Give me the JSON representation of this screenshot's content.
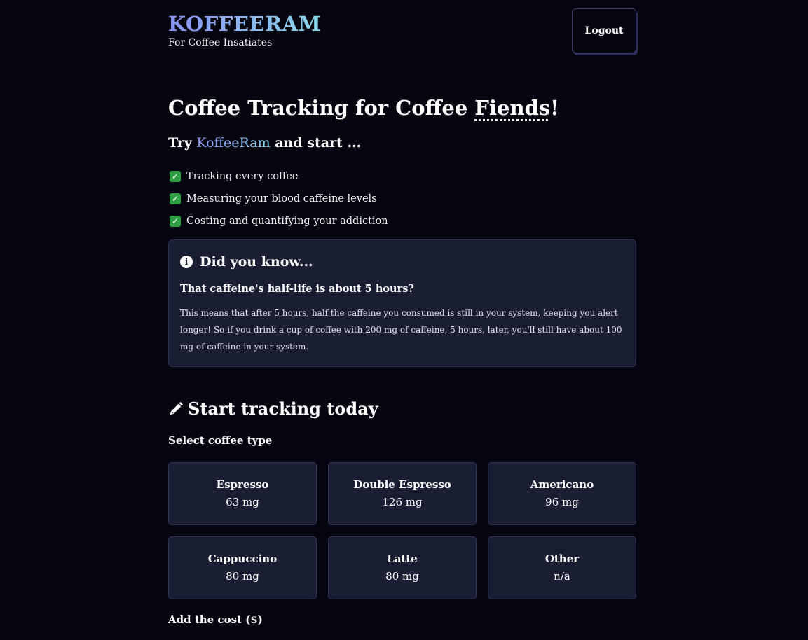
{
  "header": {
    "brand": "KOFFEERAM",
    "tagline": "For Coffee Insatiates",
    "logout_label": "Logout"
  },
  "hero": {
    "title_prefix": "Coffee Tracking for Coffee ",
    "title_underlined": "Fiends",
    "title_suffix": "!",
    "subtitle_prefix": "Try ",
    "subtitle_brand": "KoffeeRam",
    "subtitle_suffix": " and start ...",
    "features": [
      "Tracking every coffee",
      "Measuring your blood caffeine levels",
      "Costing and quantifying your addiction"
    ]
  },
  "did_you_know": {
    "heading": "Did you know...",
    "question": "That caffeine's half-life is about 5 hours?",
    "body": "This means that after 5 hours, half the caffeine you consumed is still in your system, keeping you alert longer! So if you drink a cup of coffee with 200 mg of caffeine, 5 hours, later, you'll still have about 100 mg of caffeine in your system."
  },
  "tracking": {
    "heading": "Start tracking today",
    "select_label": "Select coffee type",
    "coffees": [
      {
        "name": "Espresso",
        "caffeine": "63 mg"
      },
      {
        "name": "Double Espresso",
        "caffeine": "126 mg"
      },
      {
        "name": "Americano",
        "caffeine": "96 mg"
      },
      {
        "name": "Cappuccino",
        "caffeine": "80 mg"
      },
      {
        "name": "Latte",
        "caffeine": "80 mg"
      },
      {
        "name": "Other",
        "caffeine": "n/a"
      }
    ],
    "cost_label": "Add the cost ($)"
  },
  "colors": {
    "background": "#050510",
    "card": "#1a1e33",
    "brand_gradient_start": "#8b93f5",
    "brand_gradient_end": "#86d6e8",
    "check": "#2ea043"
  },
  "icons": {
    "check": "check-icon",
    "info": "info-icon",
    "pencil": "pencil-icon"
  }
}
